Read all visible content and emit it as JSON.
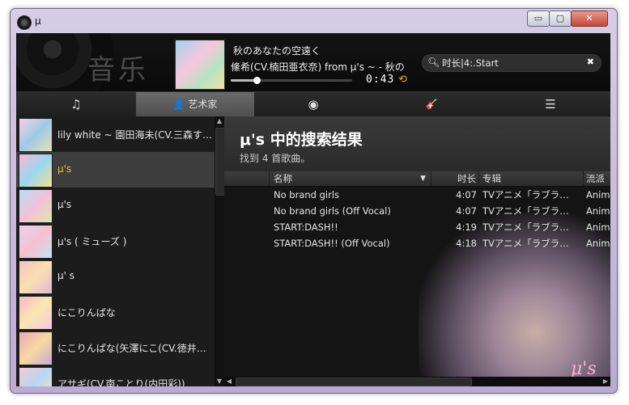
{
  "window": {
    "title": "μ",
    "min_glyph": "▭",
    "max_glyph": "▢",
    "close_glyph": "✕"
  },
  "player": {
    "logo_text": "音乐",
    "song_title": "秋のあなたの空遠く",
    "song_artist": "絛希(CV.楠田亜衣奈) from μ's ~ - 秋の",
    "time": "0:43",
    "progress_fraction": 0.21,
    "repeat_icon": "repeat-icon"
  },
  "search": {
    "value": "时长|4:.Start",
    "placeholder": ""
  },
  "tabs": [
    {
      "icon": "music-note-icon",
      "label": "",
      "glyph": "♫"
    },
    {
      "icon": "person-icon",
      "label": "艺术家",
      "glyph": "👤"
    },
    {
      "icon": "disc-icon",
      "label": "",
      "glyph": "◉"
    },
    {
      "icon": "guitar-icon",
      "label": "",
      "glyph": "🎸"
    },
    {
      "icon": "list-icon",
      "label": "",
      "glyph": "☰"
    }
  ],
  "artists": [
    {
      "name": "lily white ~ 園田海未(CV.三森すず…",
      "colors": [
        "#f4d0e0",
        "#9ecbe8",
        "#e8e0b0"
      ]
    },
    {
      "name": "μ's",
      "colors": [
        "#f6b8d4",
        "#9ad7f0",
        "#f6e08a"
      ]
    },
    {
      "name": "μ's",
      "colors": [
        "#b2e0f5",
        "#f4c0d8",
        "#d9e8a8"
      ]
    },
    {
      "name": "μ's ( ミューズ )",
      "colors": [
        "#e7d2f0",
        "#f6c0cf",
        "#bfe3f4"
      ]
    },
    {
      "name": "μ'  s",
      "colors": [
        "#f7c4c0",
        "#f8e0b0",
        "#e0b8d8"
      ]
    },
    {
      "name": "にこりんぱな",
      "colors": [
        "#f7b8c8",
        "#fbe7b0",
        "#f4c8e4"
      ]
    },
    {
      "name": "にこりんぱな(矢澤にこ(CV.徳井青…",
      "colors": [
        "#e8a8b8",
        "#f8d8a0",
        "#c8a8d0"
      ]
    },
    {
      "name": "アサギ(CV.南ことり(内田彩))",
      "colors": [
        "#f0c8d8",
        "#b8d8f0",
        "#f8e8c0"
      ]
    }
  ],
  "results": {
    "title": "μ's 中的搜索结果",
    "subtitle": "找到 4 首歌曲。",
    "columns": {
      "name": "名称",
      "duration": "时长",
      "album": "专辑",
      "genre": "流派"
    },
    "sort_icon": "▼",
    "rows": [
      {
        "name": "No brand girls",
        "duration": "4:07",
        "album": "TVアニメ「ラブラ…",
        "genre": "Anim"
      },
      {
        "name": "No brand girls (Off Vocal)",
        "duration": "4:07",
        "album": "TVアニメ「ラブラ…",
        "genre": "Anim"
      },
      {
        "name": "START:DASH!!",
        "duration": "4:19",
        "album": "TVアニメ「ラブラ…",
        "genre": "Anim"
      },
      {
        "name": "START:DASH!! (Off Vocal)",
        "duration": "4:18",
        "album": "TVアニメ「ラブラ…",
        "genre": "Anim"
      }
    ]
  },
  "background_logo": "μ's"
}
